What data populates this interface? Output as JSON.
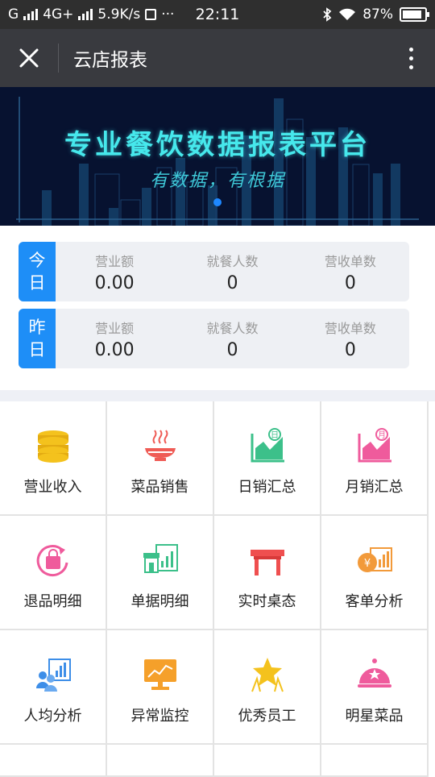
{
  "status_bar": {
    "carrier": "G",
    "network": "4G+",
    "speed": "5.9K/s",
    "time": "22:11",
    "battery": "87%",
    "battery_level": 0.87
  },
  "titlebar": {
    "title": "云店报表"
  },
  "banner": {
    "title": "专业餐饮数据报表平台",
    "subtitle": "有数据，有根据"
  },
  "stats": {
    "rows": [
      {
        "day_top": "今",
        "day_bottom": "日",
        "cells": [
          {
            "label": "营业额",
            "value": "0.00"
          },
          {
            "label": "就餐人数",
            "value": "0"
          },
          {
            "label": "营收单数",
            "value": "0"
          }
        ]
      },
      {
        "day_top": "昨",
        "day_bottom": "日",
        "cells": [
          {
            "label": "营业额",
            "value": "0.00"
          },
          {
            "label": "就餐人数",
            "value": "0"
          },
          {
            "label": "营收单数",
            "value": "0"
          }
        ]
      }
    ]
  },
  "grid": {
    "items": [
      {
        "label": "营业收入",
        "icon": "coins-icon",
        "color": "#f4c21d"
      },
      {
        "label": "菜品销售",
        "icon": "dish-icon",
        "color": "#ef5b55"
      },
      {
        "label": "日销汇总",
        "icon": "daily-chart-icon",
        "color": "#3cc08a"
      },
      {
        "label": "月销汇总",
        "icon": "monthly-chart-icon",
        "color": "#ef5b9c"
      },
      {
        "label": "退品明细",
        "icon": "return-bag-icon",
        "color": "#ef5b9c"
      },
      {
        "label": "单据明细",
        "icon": "store-receipt-icon",
        "color": "#3cc08a"
      },
      {
        "label": "实时桌态",
        "icon": "table-icon",
        "color": "#ef4f4f"
      },
      {
        "label": "客单分析",
        "icon": "yuan-chart-icon",
        "color": "#f29a3a"
      },
      {
        "label": "人均分析",
        "icon": "people-chart-icon",
        "color": "#3d8ee8"
      },
      {
        "label": "异常监控",
        "icon": "monitor-icon",
        "color": "#f5a02a"
      },
      {
        "label": "优秀员工",
        "icon": "star-award-icon",
        "color": "#f4c21d"
      },
      {
        "label": "明星菜品",
        "icon": "cloche-icon",
        "color": "#ef5b9c"
      }
    ]
  }
}
